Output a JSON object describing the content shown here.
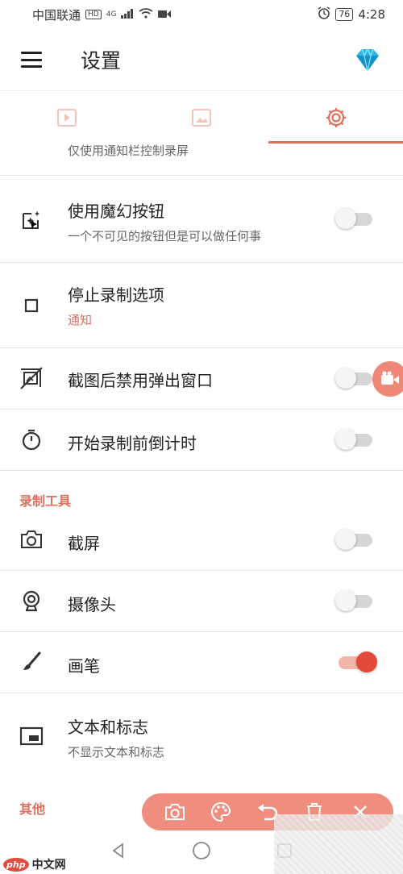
{
  "status_bar": {
    "carrier": "中国联通",
    "network_badge": "HD",
    "network_type": "4G",
    "battery": "76",
    "time": "4:28"
  },
  "app_bar": {
    "title": "设置",
    "menu_icon": "hamburger-icon",
    "premium_icon": "diamond-icon"
  },
  "tabs": [
    {
      "icon": "video-icon",
      "active": false
    },
    {
      "icon": "image-icon",
      "active": false
    },
    {
      "icon": "gear-icon",
      "active": true
    }
  ],
  "partial_row": {
    "subtitle": "仅使用通知栏控制录屏"
  },
  "settings": [
    {
      "icon": "magic-button-icon",
      "title": "使用魔幻按钮",
      "subtitle": "一个不可见的按钮但是可以做任何事",
      "toggle": false
    },
    {
      "icon": "square-icon",
      "title": "停止录制选项",
      "subtitle": "通知"
    },
    {
      "icon": "no-popup-icon",
      "title": "截图后禁用弹出窗口",
      "toggle": false
    },
    {
      "icon": "timer-icon",
      "title": "开始录制前倒计时",
      "toggle": false
    }
  ],
  "sections": {
    "tools": "录制工具",
    "other": "其他"
  },
  "tools": [
    {
      "icon": "camera-icon",
      "title": "截屏",
      "toggle": false
    },
    {
      "icon": "webcam-icon",
      "title": "摄像头",
      "toggle": false
    },
    {
      "icon": "brush-icon",
      "title": "画笔",
      "toggle": true
    },
    {
      "icon": "text-logo-icon",
      "title": "文本和标志",
      "subtitle": "不显示文本和标志"
    }
  ],
  "floating_toolbar": [
    "camera-icon",
    "palette-icon",
    "undo-icon",
    "trash-icon",
    "close-icon"
  ],
  "watermark": {
    "logo": "php",
    "text": "中文网"
  },
  "colors": {
    "accent": "#e0705e",
    "toggle_on": "#e24b3c",
    "toolbar_bg": "#ef8e7e"
  }
}
